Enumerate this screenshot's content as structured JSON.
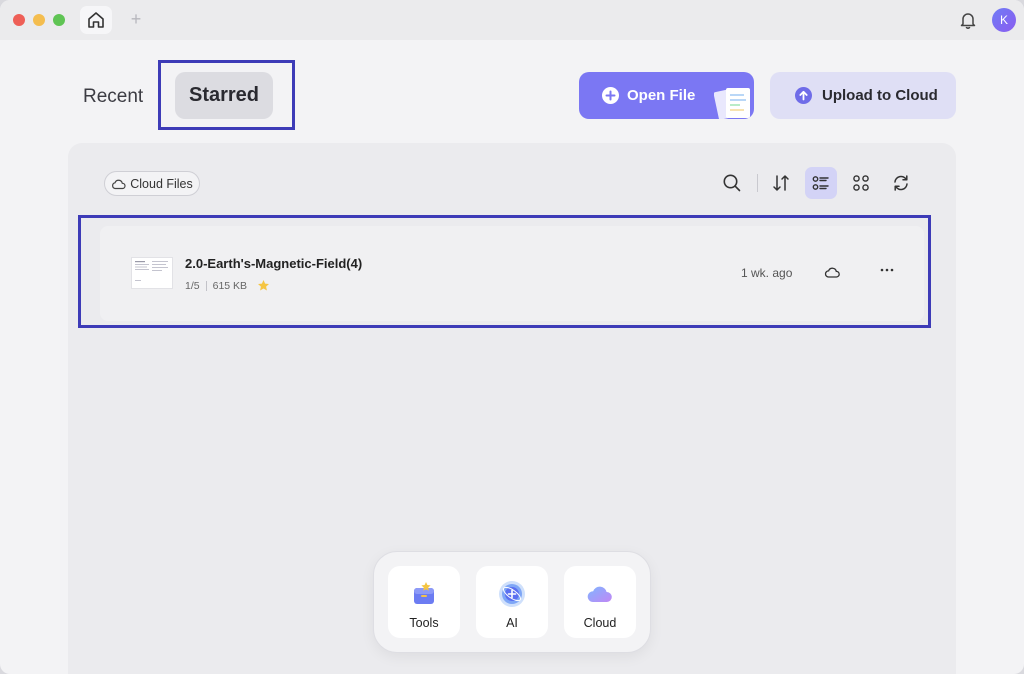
{
  "window": {
    "avatar_initial": "K"
  },
  "tabs": {
    "recent": "Recent",
    "starred": "Starred"
  },
  "actions": {
    "open_file": "Open File",
    "upload_to_cloud": "Upload to Cloud"
  },
  "toolbar": {
    "cloud_files": "Cloud Files",
    "icons": [
      "search-icon",
      "sort-icon",
      "list-view-icon",
      "grid-view-icon",
      "refresh-icon"
    ],
    "active_view": "list"
  },
  "files": [
    {
      "name": "2.0-Earth's-Magnetic-Field(4)",
      "pages": "1/5",
      "size": "615 KB",
      "starred": true,
      "modified": "1 wk. ago"
    }
  ],
  "dock": {
    "items": [
      {
        "label": "Tools",
        "icon": "toolbox-icon"
      },
      {
        "label": "AI",
        "icon": "ai-orb-icon"
      },
      {
        "label": "Cloud",
        "icon": "cloud-icon"
      }
    ]
  },
  "colors": {
    "accent": "#7b77f3",
    "upload_bg": "#dfdff5",
    "highlight_box": "#3d3bb7",
    "star": "#f5c542"
  }
}
